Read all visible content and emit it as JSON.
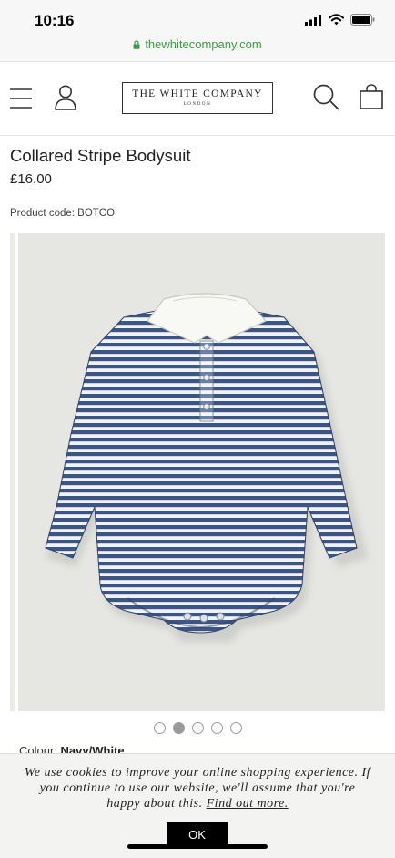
{
  "status_bar": {
    "time": "10:16",
    "url": "thewhitecompany.com",
    "url_color": "#3f9a45",
    "icons": [
      "signal-icon",
      "wifi-icon",
      "battery-icon"
    ]
  },
  "header": {
    "logo_main": "THE WHITE COMPANY",
    "logo_sub": "LONDON",
    "icons": [
      "menu-icon",
      "account-icon",
      "search-icon",
      "bag-icon"
    ]
  },
  "product": {
    "title": "Collared Stripe Bodysuit",
    "price": "£16.00",
    "code": "Product code: BOTCO",
    "colour_label": "Colour:",
    "colour_value": "Navy/White",
    "stripe_color": "#3e5580"
  },
  "gallery": {
    "image_count": 5,
    "active_index": 1
  },
  "cookie_banner": {
    "line1": "We use cookies to improve your online shopping experience. If",
    "line2": "you continue to use our website, we'll assume that you're",
    "line3_prefix": "happy about this.",
    "link_text": "Find out more.",
    "ok_label": "OK"
  }
}
